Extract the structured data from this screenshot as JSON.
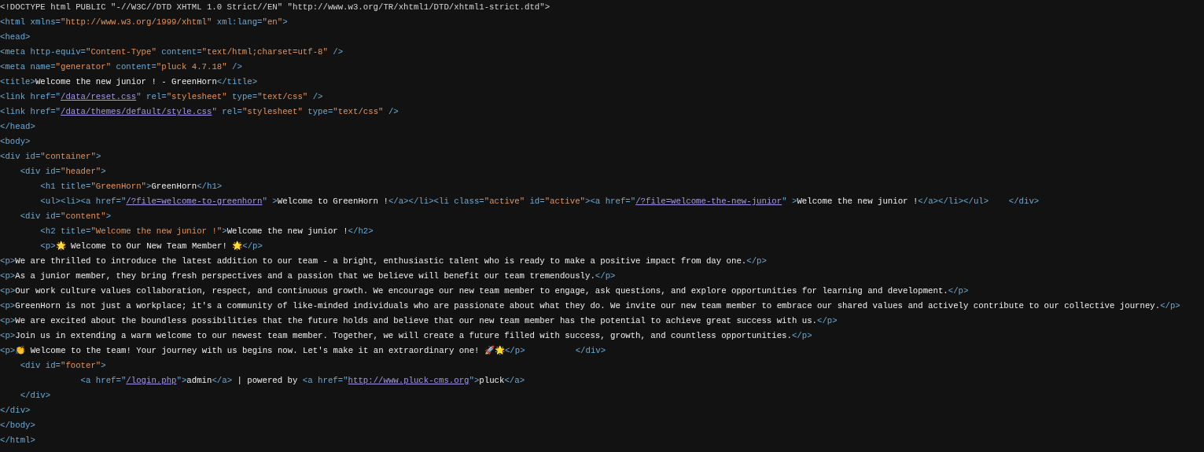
{
  "lines": [
    [
      {
        "kind": "doctype",
        "text": "<!DOCTYPE html PUBLIC \"-//W3C//DTD XHTML 1.0 Strict//EN\" \"http://www.w3.org/TR/xhtml1/DTD/xhtml1-strict.dtd\">"
      }
    ],
    [
      {
        "kind": "tag",
        "text": "<html xmlns="
      },
      {
        "kind": "value",
        "text": "\"http://www.w3.org/1999/xhtml\""
      },
      {
        "kind": "tag",
        "text": " xml:lang="
      },
      {
        "kind": "value",
        "text": "\"en\""
      },
      {
        "kind": "tag",
        "text": ">"
      }
    ],
    [
      {
        "kind": "tag",
        "text": "<head>"
      }
    ],
    [
      {
        "kind": "tag",
        "text": "<meta http-equiv="
      },
      {
        "kind": "value",
        "text": "\"Content-Type\""
      },
      {
        "kind": "tag",
        "text": " content="
      },
      {
        "kind": "value",
        "text": "\"text/html;charset=utf-8\""
      },
      {
        "kind": "tag",
        "text": " />"
      }
    ],
    [
      {
        "kind": "tag",
        "text": "<meta name="
      },
      {
        "kind": "value",
        "text": "\"generator\""
      },
      {
        "kind": "tag",
        "text": " content="
      },
      {
        "kind": "value",
        "text": "\"pluck 4.7.18\""
      },
      {
        "kind": "tag",
        "text": " />"
      }
    ],
    [
      {
        "kind": "tag",
        "text": "<title>"
      },
      {
        "kind": "text",
        "text": "Welcome the new junior ! - GreenHorn"
      },
      {
        "kind": "tag",
        "text": "</title>"
      }
    ],
    [
      {
        "kind": "tag",
        "text": "<link href=\""
      },
      {
        "kind": "link",
        "text": "/data/reset.css"
      },
      {
        "kind": "tag",
        "text": "\" rel="
      },
      {
        "kind": "value",
        "text": "\"stylesheet\""
      },
      {
        "kind": "tag",
        "text": " type="
      },
      {
        "kind": "value",
        "text": "\"text/css\""
      },
      {
        "kind": "tag",
        "text": " />"
      }
    ],
    [
      {
        "kind": "tag",
        "text": "<link href=\""
      },
      {
        "kind": "link",
        "text": "/data/themes/default/style.css"
      },
      {
        "kind": "tag",
        "text": "\" rel="
      },
      {
        "kind": "value",
        "text": "\"stylesheet\""
      },
      {
        "kind": "tag",
        "text": " type="
      },
      {
        "kind": "value",
        "text": "\"text/css\""
      },
      {
        "kind": "tag",
        "text": " />"
      }
    ],
    [
      {
        "kind": "tag",
        "text": "</head>"
      }
    ],
    [
      {
        "kind": "tag",
        "text": "<body>"
      }
    ],
    [
      {
        "kind": "tag",
        "text": "<div id="
      },
      {
        "kind": "value",
        "text": "\"container\""
      },
      {
        "kind": "tag",
        "text": ">"
      }
    ],
    [
      {
        "kind": "tag",
        "text": "    <div id="
      },
      {
        "kind": "value",
        "text": "\"header\""
      },
      {
        "kind": "tag",
        "text": ">"
      }
    ],
    [
      {
        "kind": "tag",
        "text": "        <h1 title="
      },
      {
        "kind": "value",
        "text": "\"GreenHorn\""
      },
      {
        "kind": "tag",
        "text": ">"
      },
      {
        "kind": "text",
        "text": "GreenHorn"
      },
      {
        "kind": "tag",
        "text": "</h1>"
      }
    ],
    [
      {
        "kind": "tag",
        "text": "        <ul><li><a href=\""
      },
      {
        "kind": "link",
        "text": "/?file=welcome-to-greenhorn"
      },
      {
        "kind": "tag",
        "text": "\" >"
      },
      {
        "kind": "text",
        "text": "Welcome to GreenHorn !"
      },
      {
        "kind": "tag",
        "text": "</a></li><li class="
      },
      {
        "kind": "value",
        "text": "\"active\""
      },
      {
        "kind": "tag",
        "text": " id="
      },
      {
        "kind": "value",
        "text": "\"active\""
      },
      {
        "kind": "tag",
        "text": "><a href=\""
      },
      {
        "kind": "link",
        "text": "/?file=welcome-the-new-junior"
      },
      {
        "kind": "tag",
        "text": "\" >"
      },
      {
        "kind": "text",
        "text": "Welcome the new junior !"
      },
      {
        "kind": "tag",
        "text": "</a></li></ul>    </div>"
      }
    ],
    [
      {
        "kind": "tag",
        "text": "    <div id="
      },
      {
        "kind": "value",
        "text": "\"content\""
      },
      {
        "kind": "tag",
        "text": ">"
      }
    ],
    [
      {
        "kind": "tag",
        "text": "        <h2 title="
      },
      {
        "kind": "value",
        "text": "\"Welcome the new junior !\""
      },
      {
        "kind": "tag",
        "text": ">"
      },
      {
        "kind": "text",
        "text": "Welcome the new junior !"
      },
      {
        "kind": "tag",
        "text": "</h2>"
      }
    ],
    [
      {
        "kind": "tag",
        "text": "        <p>"
      },
      {
        "kind": "text",
        "text": "🌟 Welcome to Our New Team Member! 🌟"
      },
      {
        "kind": "tag",
        "text": "</p>"
      }
    ],
    [
      {
        "kind": "tag",
        "text": "<p>"
      },
      {
        "kind": "text",
        "text": "We are thrilled to introduce the latest addition to our team - a bright, enthusiastic talent who is ready to make a positive impact from day one."
      },
      {
        "kind": "tag",
        "text": "</p>"
      }
    ],
    [
      {
        "kind": "tag",
        "text": "<p>"
      },
      {
        "kind": "text",
        "text": "As a junior member, they bring fresh perspectives and a passion that we believe will benefit our team tremendously."
      },
      {
        "kind": "tag",
        "text": "</p>"
      }
    ],
    [
      {
        "kind": "tag",
        "text": "<p>"
      },
      {
        "kind": "text",
        "text": "Our work culture values collaboration, respect, and continuous growth. We encourage our new team member to engage, ask questions, and explore opportunities for learning and development."
      },
      {
        "kind": "tag",
        "text": "</p>"
      }
    ],
    [
      {
        "kind": "tag",
        "text": "<p>"
      },
      {
        "kind": "text",
        "text": "GreenHorn is not just a workplace; it's a community of like-minded individuals who are passionate about what they do. We invite our new team member to embrace our shared values and actively contribute to our collective journey."
      },
      {
        "kind": "tag",
        "text": "</p>"
      }
    ],
    [
      {
        "kind": "tag",
        "text": "<p>"
      },
      {
        "kind": "text",
        "text": "We are excited about the boundless possibilities that the future holds and believe that our new team member has the potential to achieve great success with us."
      },
      {
        "kind": "tag",
        "text": "</p>"
      }
    ],
    [
      {
        "kind": "tag",
        "text": "<p>"
      },
      {
        "kind": "text",
        "text": "Join us in extending a warm welcome to our newest team member. Together, we will create a future filled with success, growth, and countless opportunities."
      },
      {
        "kind": "tag",
        "text": "</p>"
      }
    ],
    [
      {
        "kind": "tag",
        "text": "<p>"
      },
      {
        "kind": "text",
        "text": "👏 Welcome to the team! Your journey with us begins now. Let's make it an extraordinary one! 🚀🌟"
      },
      {
        "kind": "tag",
        "text": "</p>          </div>"
      }
    ],
    [
      {
        "kind": "tag",
        "text": "    <div id="
      },
      {
        "kind": "value",
        "text": "\"footer\""
      },
      {
        "kind": "tag",
        "text": ">"
      }
    ],
    [
      {
        "kind": "tag",
        "text": "                <a href=\""
      },
      {
        "kind": "link",
        "text": "/login.php"
      },
      {
        "kind": "tag",
        "text": "\">"
      },
      {
        "kind": "text",
        "text": "admin"
      },
      {
        "kind": "tag",
        "text": "</a>"
      },
      {
        "kind": "text",
        "text": " | powered by "
      },
      {
        "kind": "tag",
        "text": "<a href=\""
      },
      {
        "kind": "link",
        "text": "http://www.pluck-cms.org"
      },
      {
        "kind": "tag",
        "text": "\">"
      },
      {
        "kind": "text",
        "text": "pluck"
      },
      {
        "kind": "tag",
        "text": "</a>"
      }
    ],
    [
      {
        "kind": "tag",
        "text": "    </div>"
      }
    ],
    [
      {
        "kind": "tag",
        "text": "</div>"
      }
    ],
    [
      {
        "kind": "tag",
        "text": "</body>"
      }
    ],
    [
      {
        "kind": "tag",
        "text": "</html>"
      }
    ]
  ]
}
